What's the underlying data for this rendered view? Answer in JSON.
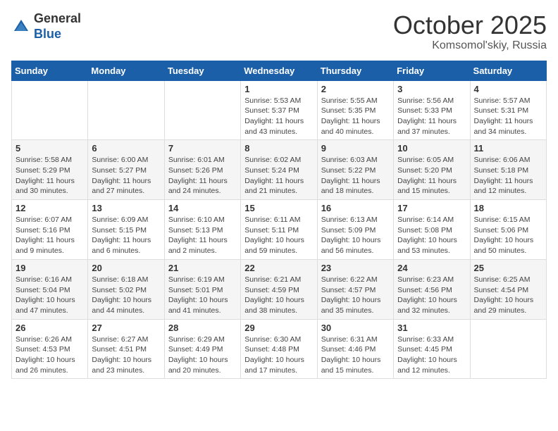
{
  "logo": {
    "general": "General",
    "blue": "Blue"
  },
  "header": {
    "month": "October 2025",
    "location": "Komsomol'skiy, Russia"
  },
  "weekdays": [
    "Sunday",
    "Monday",
    "Tuesday",
    "Wednesday",
    "Thursday",
    "Friday",
    "Saturday"
  ],
  "weeks": [
    [
      {
        "day": "",
        "info": ""
      },
      {
        "day": "",
        "info": ""
      },
      {
        "day": "",
        "info": ""
      },
      {
        "day": "1",
        "info": "Sunrise: 5:53 AM\nSunset: 5:37 PM\nDaylight: 11 hours\nand 43 minutes."
      },
      {
        "day": "2",
        "info": "Sunrise: 5:55 AM\nSunset: 5:35 PM\nDaylight: 11 hours\nand 40 minutes."
      },
      {
        "day": "3",
        "info": "Sunrise: 5:56 AM\nSunset: 5:33 PM\nDaylight: 11 hours\nand 37 minutes."
      },
      {
        "day": "4",
        "info": "Sunrise: 5:57 AM\nSunset: 5:31 PM\nDaylight: 11 hours\nand 34 minutes."
      }
    ],
    [
      {
        "day": "5",
        "info": "Sunrise: 5:58 AM\nSunset: 5:29 PM\nDaylight: 11 hours\nand 30 minutes."
      },
      {
        "day": "6",
        "info": "Sunrise: 6:00 AM\nSunset: 5:27 PM\nDaylight: 11 hours\nand 27 minutes."
      },
      {
        "day": "7",
        "info": "Sunrise: 6:01 AM\nSunset: 5:26 PM\nDaylight: 11 hours\nand 24 minutes."
      },
      {
        "day": "8",
        "info": "Sunrise: 6:02 AM\nSunset: 5:24 PM\nDaylight: 11 hours\nand 21 minutes."
      },
      {
        "day": "9",
        "info": "Sunrise: 6:03 AM\nSunset: 5:22 PM\nDaylight: 11 hours\nand 18 minutes."
      },
      {
        "day": "10",
        "info": "Sunrise: 6:05 AM\nSunset: 5:20 PM\nDaylight: 11 hours\nand 15 minutes."
      },
      {
        "day": "11",
        "info": "Sunrise: 6:06 AM\nSunset: 5:18 PM\nDaylight: 11 hours\nand 12 minutes."
      }
    ],
    [
      {
        "day": "12",
        "info": "Sunrise: 6:07 AM\nSunset: 5:16 PM\nDaylight: 11 hours\nand 9 minutes."
      },
      {
        "day": "13",
        "info": "Sunrise: 6:09 AM\nSunset: 5:15 PM\nDaylight: 11 hours\nand 6 minutes."
      },
      {
        "day": "14",
        "info": "Sunrise: 6:10 AM\nSunset: 5:13 PM\nDaylight: 11 hours\nand 2 minutes."
      },
      {
        "day": "15",
        "info": "Sunrise: 6:11 AM\nSunset: 5:11 PM\nDaylight: 10 hours\nand 59 minutes."
      },
      {
        "day": "16",
        "info": "Sunrise: 6:13 AM\nSunset: 5:09 PM\nDaylight: 10 hours\nand 56 minutes."
      },
      {
        "day": "17",
        "info": "Sunrise: 6:14 AM\nSunset: 5:08 PM\nDaylight: 10 hours\nand 53 minutes."
      },
      {
        "day": "18",
        "info": "Sunrise: 6:15 AM\nSunset: 5:06 PM\nDaylight: 10 hours\nand 50 minutes."
      }
    ],
    [
      {
        "day": "19",
        "info": "Sunrise: 6:16 AM\nSunset: 5:04 PM\nDaylight: 10 hours\nand 47 minutes."
      },
      {
        "day": "20",
        "info": "Sunrise: 6:18 AM\nSunset: 5:02 PM\nDaylight: 10 hours\nand 44 minutes."
      },
      {
        "day": "21",
        "info": "Sunrise: 6:19 AM\nSunset: 5:01 PM\nDaylight: 10 hours\nand 41 minutes."
      },
      {
        "day": "22",
        "info": "Sunrise: 6:21 AM\nSunset: 4:59 PM\nDaylight: 10 hours\nand 38 minutes."
      },
      {
        "day": "23",
        "info": "Sunrise: 6:22 AM\nSunset: 4:57 PM\nDaylight: 10 hours\nand 35 minutes."
      },
      {
        "day": "24",
        "info": "Sunrise: 6:23 AM\nSunset: 4:56 PM\nDaylight: 10 hours\nand 32 minutes."
      },
      {
        "day": "25",
        "info": "Sunrise: 6:25 AM\nSunset: 4:54 PM\nDaylight: 10 hours\nand 29 minutes."
      }
    ],
    [
      {
        "day": "26",
        "info": "Sunrise: 6:26 AM\nSunset: 4:53 PM\nDaylight: 10 hours\nand 26 minutes."
      },
      {
        "day": "27",
        "info": "Sunrise: 6:27 AM\nSunset: 4:51 PM\nDaylight: 10 hours\nand 23 minutes."
      },
      {
        "day": "28",
        "info": "Sunrise: 6:29 AM\nSunset: 4:49 PM\nDaylight: 10 hours\nand 20 minutes."
      },
      {
        "day": "29",
        "info": "Sunrise: 6:30 AM\nSunset: 4:48 PM\nDaylight: 10 hours\nand 17 minutes."
      },
      {
        "day": "30",
        "info": "Sunrise: 6:31 AM\nSunset: 4:46 PM\nDaylight: 10 hours\nand 15 minutes."
      },
      {
        "day": "31",
        "info": "Sunrise: 6:33 AM\nSunset: 4:45 PM\nDaylight: 10 hours\nand 12 minutes."
      },
      {
        "day": "",
        "info": ""
      }
    ]
  ]
}
